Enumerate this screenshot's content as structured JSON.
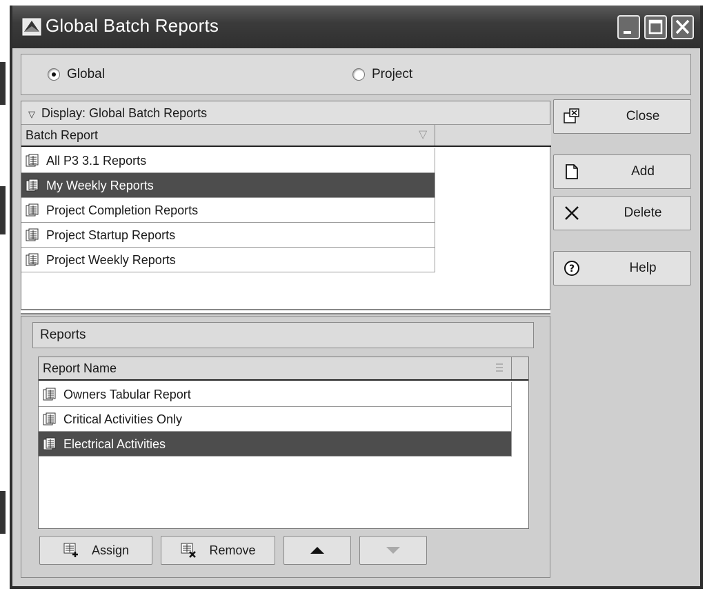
{
  "window": {
    "title": "Global Batch Reports",
    "controls": [
      "minimize",
      "maximize",
      "close"
    ]
  },
  "scope": {
    "options": [
      {
        "label": "Global",
        "selected": true
      },
      {
        "label": "Project",
        "selected": false
      }
    ]
  },
  "batch_panel": {
    "display_label": "Display: Global Batch Reports",
    "column_header": "Batch Report",
    "rows": [
      {
        "label": "All P3 3.1 Reports",
        "selected": false
      },
      {
        "label": "My Weekly Reports",
        "selected": true
      },
      {
        "label": "Project Completion Reports",
        "selected": false
      },
      {
        "label": "Project Startup Reports",
        "selected": false
      },
      {
        "label": "Project Weekly Reports",
        "selected": false
      }
    ]
  },
  "reports_panel": {
    "title": "Reports",
    "column_header": "Report Name",
    "rows": [
      {
        "label": "Owners Tabular Report",
        "selected": false
      },
      {
        "label": "Critical Activities Only",
        "selected": false
      },
      {
        "label": "Electrical Activities",
        "selected": true
      }
    ],
    "buttons": {
      "assign": "Assign",
      "remove": "Remove",
      "up_icon": "triangle-up-icon",
      "down_icon": "triangle-down-icon"
    }
  },
  "side_buttons": {
    "close": "Close",
    "add": "Add",
    "delete": "Delete",
    "help": "Help"
  },
  "colors": {
    "titlebar": "#3b3b3b",
    "selection": "#4d4d4d",
    "panel": "#cfcfcf"
  }
}
